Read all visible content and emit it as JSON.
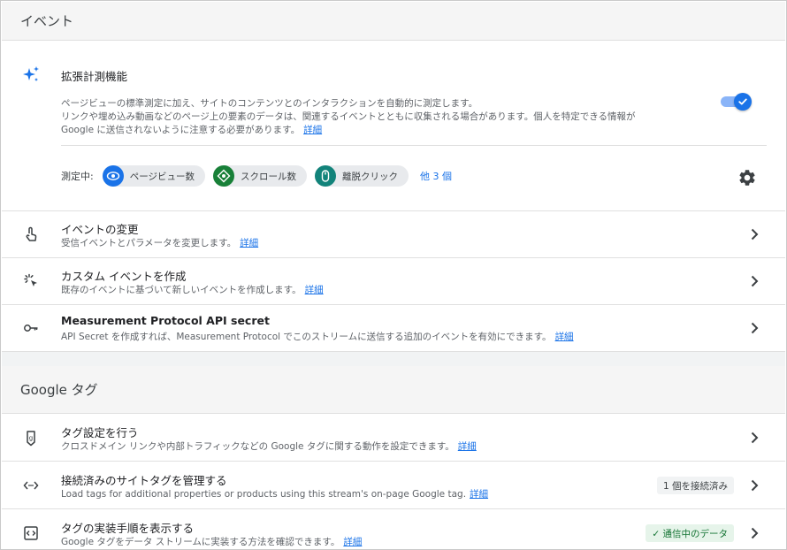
{
  "events_section": {
    "header": "イベント",
    "enhanced": {
      "title": "拡張計測機能",
      "desc1": "ページビューの標準測定に加え、サイトのコンテンツとのインタラクションを自動的に測定します。",
      "desc2": "リンクや埋め込み動画などのページ上の要素のデータは、関連するイベントとともに収集される場合があります。個人を特定できる情報が",
      "desc3": "Google に送信されないように注意する必要があります。",
      "learn_more": "詳細",
      "toggle_on": true,
      "measuring_label": "測定中:",
      "chips": [
        {
          "label": "ページビュー数",
          "icon": "eye-icon",
          "color": "#1a73e8"
        },
        {
          "label": "スクロール数",
          "icon": "crosshair-icon",
          "color": "#188038"
        },
        {
          "label": "離脱クリック",
          "icon": "mouse-icon",
          "color": "#12837a"
        }
      ],
      "more_label": "他 3 個"
    },
    "rows": [
      {
        "title": "イベントの変更",
        "desc": "受信イベントとパラメータを変更します。",
        "link": "詳細",
        "icon": "touch-icon"
      },
      {
        "title": "カスタム イベントを作成",
        "desc": "既存のイベントに基づいて新しいイベントを作成します。",
        "link": "詳細",
        "icon": "sparkle-click-icon"
      },
      {
        "title": "Measurement Protocol API secret",
        "desc": "API Secret を作成すれば、Measurement Protocol でこのストリームに送信する追加のイベントを有効にできます。",
        "link": "詳細",
        "icon": "key-icon"
      }
    ]
  },
  "google_tag_section": {
    "header": "Google タグ",
    "rows": [
      {
        "title": "タグ設定を行う",
        "desc": "クロスドメイン リンクや内部トラフィックなどの Google タグに関する動作を設定できます。",
        "link": "詳細",
        "icon": "tag-icon"
      },
      {
        "title": "接続済みのサイトタグを管理する",
        "desc": "Load tags for additional properties or products using this stream's on-page Google tag.",
        "link": "詳細",
        "icon": "code-icon",
        "badge": "1 個を接続済み"
      },
      {
        "title": "タグの実装手順を表示する",
        "desc": "Google タグをデータ ストリームに実装する方法を確認できます。",
        "link": "詳細",
        "icon": "tag-code-icon",
        "badge": "✓ 通信中のデータ",
        "badge_color": "#137333"
      }
    ]
  }
}
